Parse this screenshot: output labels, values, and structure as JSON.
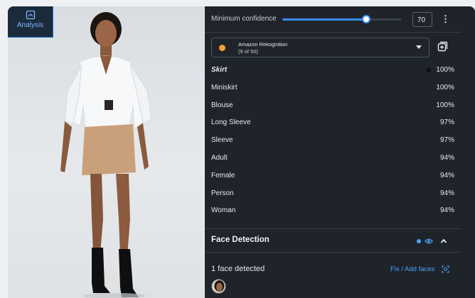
{
  "sidebar": {
    "analysis_tab": {
      "label": "Analysis",
      "icon": "analysis-icon",
      "active": true
    }
  },
  "confidence": {
    "label": "Minimum confidence",
    "value": "70",
    "slider_percent": 70,
    "menu_icon": "kebab-menu-icon"
  },
  "provider": {
    "name": "Amazon Rekognition",
    "count": "(9 of 50)",
    "dot_color": "#f0a33a",
    "add_icon": "add-copy-icon"
  },
  "labels": [
    {
      "name": "Skirt",
      "confidence": "100%",
      "selected": true
    },
    {
      "name": "Miniskirt",
      "confidence": "100%"
    },
    {
      "name": "Blouse",
      "confidence": "100%"
    },
    {
      "name": "Long Sleeve",
      "confidence": "97%"
    },
    {
      "name": "Sleeve",
      "confidence": "97%"
    },
    {
      "name": "Adult",
      "confidence": "94%"
    },
    {
      "name": "Female",
      "confidence": "94%"
    },
    {
      "name": "Person",
      "confidence": "94%"
    },
    {
      "name": "Woman",
      "confidence": "94%"
    }
  ],
  "face_detection": {
    "title": "Face Detection",
    "status_color": "#4aa3ff",
    "faces_detected": "1 face detected",
    "fix_label": "Fix / Add faces"
  },
  "colors": {
    "panel_bg": "#1f242b",
    "accent": "#3b8cf5",
    "link": "#4aa3ff"
  }
}
